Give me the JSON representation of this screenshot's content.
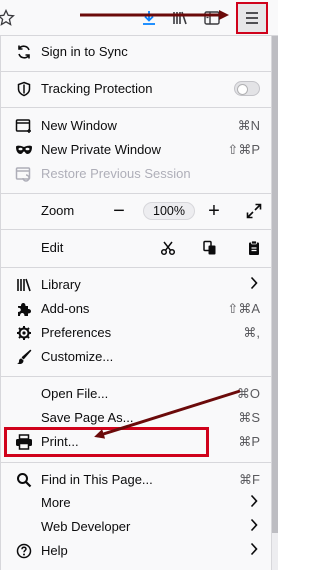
{
  "colors": {
    "accent": "#d0021b",
    "arrow": "#6b0a0a",
    "download": "#0a84ff"
  },
  "toolbar": {
    "icons": [
      "star-icon",
      "download-icon",
      "library-icon",
      "reader-sidebar-icon",
      "hamburger-menu-icon"
    ]
  },
  "menu": {
    "sync": "Sign in to Sync",
    "tracking": "Tracking Protection",
    "new_window": {
      "label": "New Window",
      "shortcut": "⌘N"
    },
    "new_private": {
      "label": "New Private Window",
      "shortcut": "⇧⌘P"
    },
    "restore": "Restore Previous Session",
    "zoom": {
      "label": "Zoom",
      "value": "100%",
      "minus": "−",
      "plus": "+"
    },
    "edit": "Edit",
    "library": "Library",
    "addons": {
      "label": "Add-ons",
      "shortcut": "⇧⌘A"
    },
    "preferences": {
      "label": "Preferences",
      "shortcut": "⌘,"
    },
    "customize": "Customize...",
    "open_file": {
      "label": "Open File...",
      "shortcut": "⌘O"
    },
    "save_page": {
      "label": "Save Page As...",
      "shortcut": "⌘S"
    },
    "print": {
      "label": "Print...",
      "shortcut": "⌘P"
    },
    "find": {
      "label": "Find in This Page...",
      "shortcut": "⌘F"
    },
    "more": "More",
    "web_developer": "Web Developer",
    "help": "Help"
  }
}
